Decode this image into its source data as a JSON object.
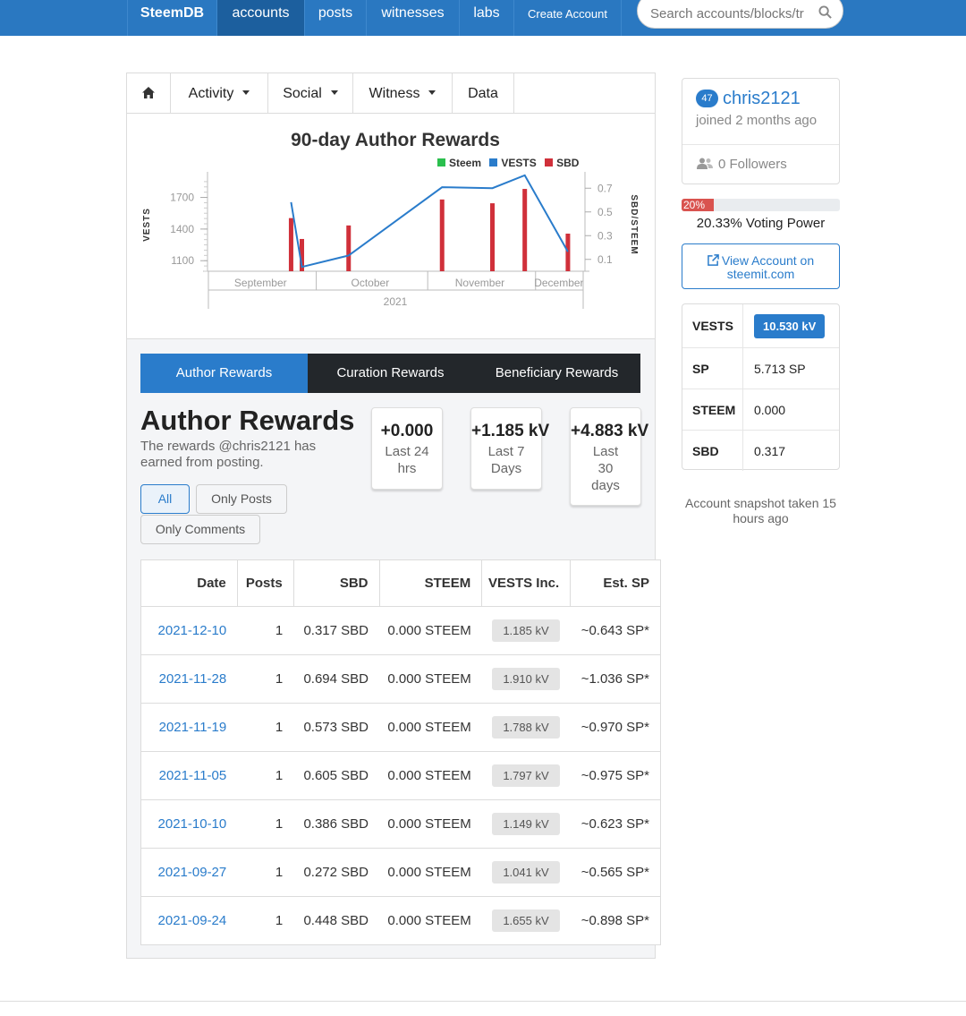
{
  "nav": {
    "brand": "SteemDB",
    "items": [
      {
        "label": "accounts"
      },
      {
        "label": "posts"
      },
      {
        "label": "witnesses"
      },
      {
        "label": "labs"
      },
      {
        "label": "Create Account"
      }
    ],
    "search_placeholder": "Search accounts/blocks/tr"
  },
  "tabs": {
    "activity": "Activity",
    "social": "Social",
    "witness": "Witness",
    "data": "Data"
  },
  "chart_data": {
    "type": "bar",
    "title": "90-day Author Rewards",
    "legend": [
      "Steem",
      "VESTS",
      "SBD"
    ],
    "x_ticks": [
      "September",
      "October",
      "November",
      "December"
    ],
    "x_year": "2021",
    "ylabel": "VESTS",
    "y2label": "SBD/STEEM",
    "y_ticks": [
      "1100",
      "1400",
      "1700"
    ],
    "y2_ticks": [
      "0.1",
      "0.3",
      "0.5",
      "0.7"
    ],
    "y_range": [
      1000,
      1900
    ],
    "y2_range": [
      0,
      0.8
    ],
    "dates": [
      "2021-09-24",
      "2021-09-27",
      "2021-10-10",
      "2021-11-05",
      "2021-11-19",
      "2021-11-28",
      "2021-12-10"
    ],
    "series": [
      {
        "name": "VESTS",
        "type": "line",
        "values": [
          1655,
          1041,
          1149,
          1797,
          1788,
          1910,
          1185
        ]
      },
      {
        "name": "SBD",
        "type": "bar",
        "values": [
          0.448,
          0.272,
          0.386,
          0.605,
          0.573,
          0.694,
          0.317
        ]
      },
      {
        "name": "Steem",
        "type": "bar",
        "values": [
          0,
          0,
          0,
          0,
          0,
          0,
          0
        ]
      }
    ],
    "colors": {
      "Steem": "#2bbf4e",
      "VESTS": "#2a7ccb",
      "SBD": "#d0303a"
    }
  },
  "reward_tabs": [
    "Author Rewards",
    "Curation Rewards",
    "Beneficiary Rewards"
  ],
  "author": {
    "title": "Author Rewards",
    "desc": "The rewards @chris2121 has earned from posting.",
    "stats": [
      {
        "value": "+0.000",
        "label": "Last 24 hrs"
      },
      {
        "value": "+1.185 kV",
        "label": "Last 7 Days"
      },
      {
        "value": "+4.883 kV",
        "label": "Last 30 days"
      }
    ],
    "filters": [
      "All",
      "Only Posts",
      "Only Comments"
    ]
  },
  "table": {
    "headers": [
      "Date",
      "Posts",
      "SBD",
      "STEEM",
      "VESTS Inc.",
      "Est. SP"
    ],
    "rows": [
      {
        "date": "2021-12-10",
        "posts": "1",
        "sbd": "0.317 SBD",
        "steem": "0.000 STEEM",
        "vests": "1.185 kV",
        "sp": "~0.643 SP*"
      },
      {
        "date": "2021-11-28",
        "posts": "1",
        "sbd": "0.694 SBD",
        "steem": "0.000 STEEM",
        "vests": "1.910 kV",
        "sp": "~1.036 SP*"
      },
      {
        "date": "2021-11-19",
        "posts": "1",
        "sbd": "0.573 SBD",
        "steem": "0.000 STEEM",
        "vests": "1.788 kV",
        "sp": "~0.970 SP*"
      },
      {
        "date": "2021-11-05",
        "posts": "1",
        "sbd": "0.605 SBD",
        "steem": "0.000 STEEM",
        "vests": "1.797 kV",
        "sp": "~0.975 SP*"
      },
      {
        "date": "2021-10-10",
        "posts": "1",
        "sbd": "0.386 SBD",
        "steem": "0.000 STEEM",
        "vests": "1.149 kV",
        "sp": "~0.623 SP*"
      },
      {
        "date": "2021-09-27",
        "posts": "1",
        "sbd": "0.272 SBD",
        "steem": "0.000 STEEM",
        "vests": "1.041 kV",
        "sp": "~0.565 SP*"
      },
      {
        "date": "2021-09-24",
        "posts": "1",
        "sbd": "0.448 SBD",
        "steem": "0.000 STEEM",
        "vests": "1.655 kV",
        "sp": "~0.898 SP*"
      }
    ]
  },
  "profile": {
    "reputation": "47",
    "username": "chris2121",
    "joined": "joined 2 months ago",
    "followers": "0 Followers",
    "voting_badge": "20%",
    "voting_fraction": 0.2033,
    "voting_power": "20.33% Voting Power",
    "view_account": "View Account on steemit.com"
  },
  "balances": [
    {
      "key": "VESTS",
      "value": "10.530 kV"
    },
    {
      "key": "SP",
      "value": "5.713 SP"
    },
    {
      "key": "STEEM",
      "value": "0.000"
    },
    {
      "key": "SBD",
      "value": "0.317"
    }
  ],
  "snapshot": "Account snapshot taken 15 hours ago"
}
